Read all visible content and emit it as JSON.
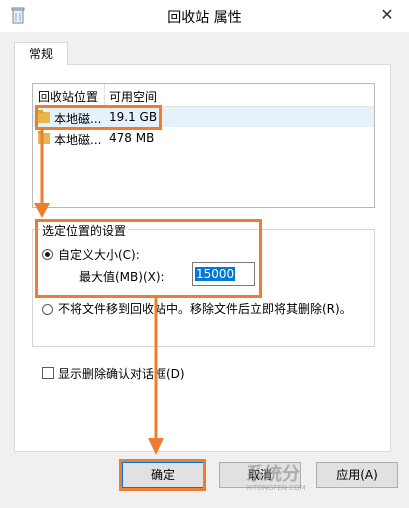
{
  "window": {
    "title": "回收站 属性",
    "close_glyph": "✕"
  },
  "tabs": [
    {
      "label": "常规"
    }
  ],
  "location_list": {
    "columns": [
      "回收站位置",
      "可用空间"
    ],
    "rows": [
      {
        "name": "本地磁...",
        "space": "19.1 GB",
        "selected": true
      },
      {
        "name": "本地磁...",
        "space": "478 MB",
        "selected": false
      }
    ]
  },
  "settings": {
    "group_label": "选定位置的设置",
    "custom_size_label": "自定义大小(C):",
    "max_label": "最大值(MB)(X):",
    "max_value": "15000",
    "no_recycle_label": "不将文件移到回收站中。移除文件后立即将其删除(R)。",
    "confirm_label": "显示删除确认对话框(D)"
  },
  "buttons": {
    "ok": "确定",
    "cancel": "取消",
    "apply": "应用(A)"
  },
  "watermark": {
    "line1": "系统分",
    "line2": "XITONGFEN.COM"
  },
  "colors": {
    "highlight": "#ed7d31",
    "accent": "#0078d7"
  }
}
